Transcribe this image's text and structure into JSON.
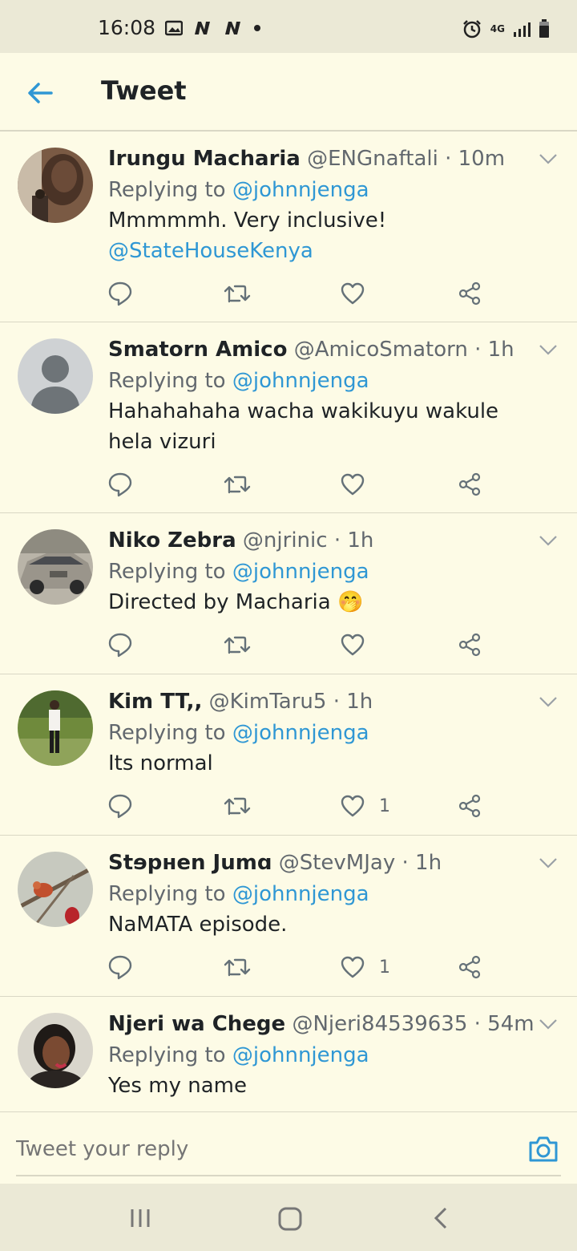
{
  "status_bar": {
    "time": "16:08",
    "network": "4G"
  },
  "header": {
    "title": "Tweet"
  },
  "colors": {
    "accent": "#2f97d4",
    "background": "#fdfbe6",
    "muted_text": "#62686e"
  },
  "tweets": [
    {
      "name": "Irungu Macharia",
      "handle": "@ENGnaftali",
      "time": "· 10m",
      "replying_prefix": "Replying to",
      "replying_to": "@johnnjenga",
      "text": "Mmmmmh. Very inclusive!",
      "mention": "@StateHouseKenya",
      "like_count": ""
    },
    {
      "name": "Smatorn Amico",
      "handle": "@AmicoSmatorn",
      "time": "· 1h",
      "replying_prefix": "Replying to",
      "replying_to": "@johnnjenga",
      "text": "Hahahahaha wacha wakikuyu wakule hela vizuri",
      "like_count": ""
    },
    {
      "name": "Niko Zebra",
      "handle": "@njrinic",
      "time": "· 1h",
      "replying_prefix": "Replying to",
      "replying_to": "@johnnjenga",
      "text": "Directed by Macharia",
      "emoji": "🤭",
      "like_count": ""
    },
    {
      "name": "Kim TT,,",
      "handle": "@KimTaru5",
      "time": "· 1h",
      "replying_prefix": "Replying to",
      "replying_to": "@johnnjenga",
      "text": "Its normal",
      "like_count": "1"
    },
    {
      "name": "Stɘpнen Jumɑ",
      "handle": "@StevMJay",
      "time": "· 1h",
      "replying_prefix": "Replying to",
      "replying_to": "@johnnjenga",
      "text": "NaMATA episode.",
      "like_count": "1"
    },
    {
      "name": "Njeri wa Chege",
      "handle": "@Njeri84539635",
      "time": "· 54m",
      "replying_prefix": "Replying to",
      "replying_to": "@johnnjenga",
      "text": "Yes my name"
    }
  ],
  "reply_bar": {
    "placeholder": "Tweet your reply"
  },
  "icons": {
    "back": "arrow-left-icon",
    "reply": "comment-icon",
    "retweet": "retweet-icon",
    "like": "heart-icon",
    "share": "share-icon",
    "more": "chevron-down-icon",
    "camera": "camera-icon"
  }
}
